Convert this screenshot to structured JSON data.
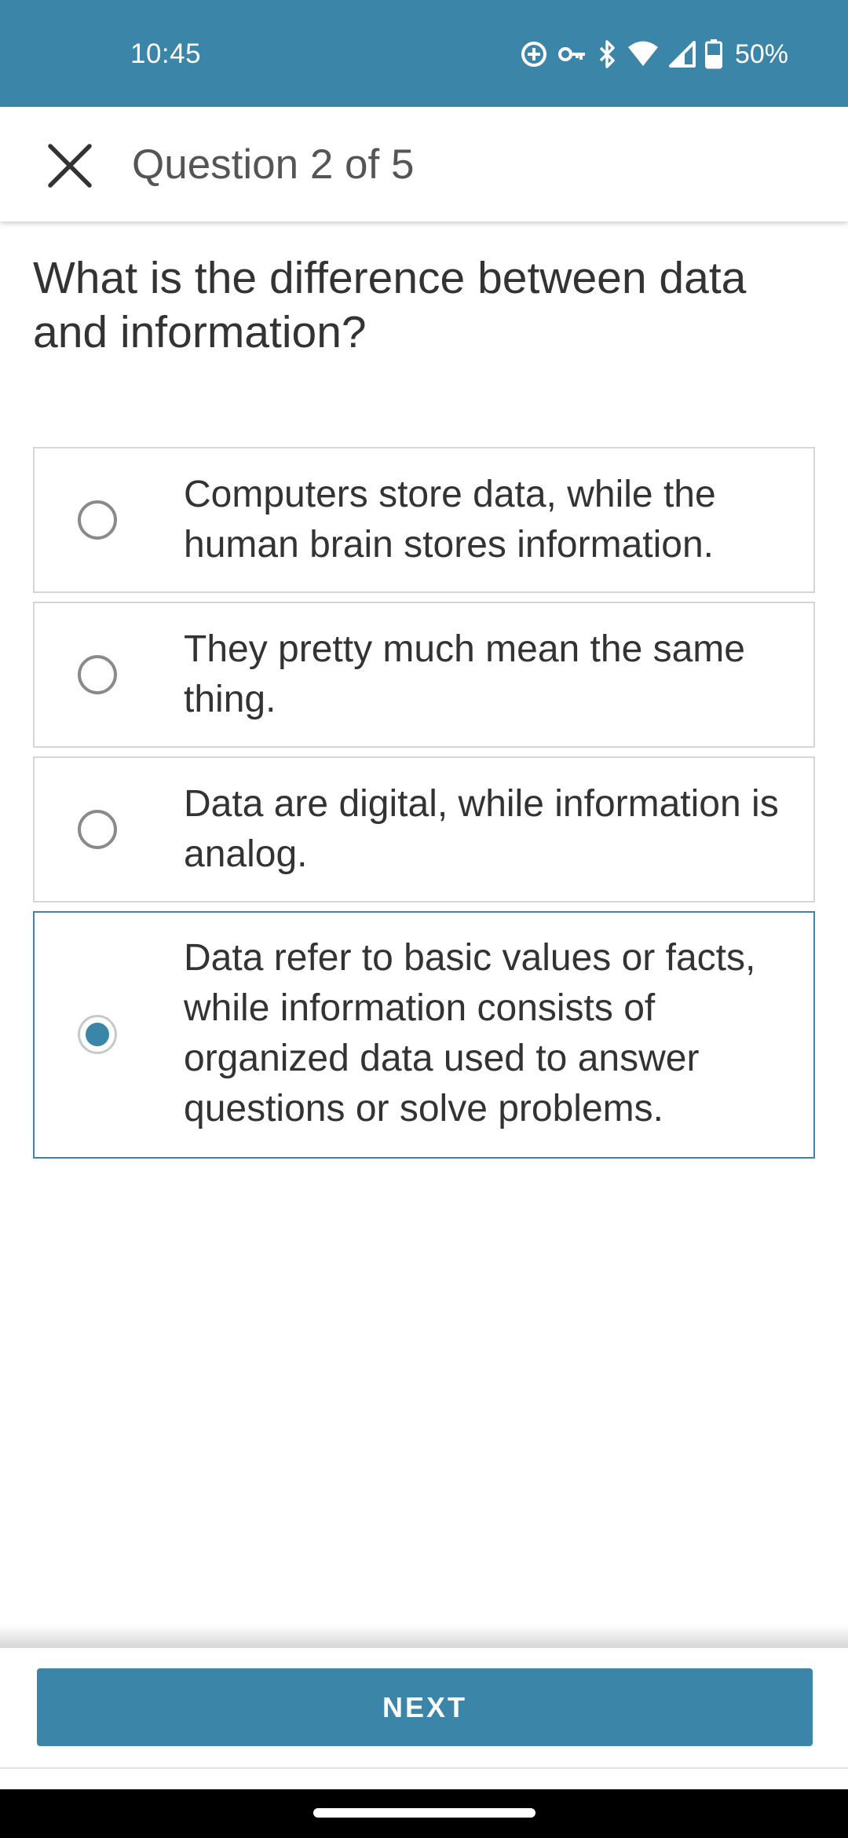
{
  "status_bar": {
    "time": "10:45",
    "battery": "50%",
    "icons": [
      "data-saver-icon",
      "vpn-key-icon",
      "bluetooth-icon",
      "wifi-icon",
      "cell-signal-icon",
      "battery-icon"
    ]
  },
  "header": {
    "title": "Question 2 of 5",
    "close_icon": "close-icon"
  },
  "question": {
    "text": "What is the difference between data and information?"
  },
  "options": [
    {
      "label": "Computers store data, while the human brain stores information.",
      "selected": false
    },
    {
      "label": "They pretty much mean the same thing.",
      "selected": false
    },
    {
      "label": "Data are digital, while information is analog.",
      "selected": false
    },
    {
      "label": "Data refer to basic values or facts, while information consists of organized data used to answer questions or solve problems.",
      "selected": true
    }
  ],
  "footer": {
    "next_label": "NEXT"
  },
  "colors": {
    "accent": "#3a85a8",
    "text": "#333333",
    "border": "#d6d6d6"
  }
}
